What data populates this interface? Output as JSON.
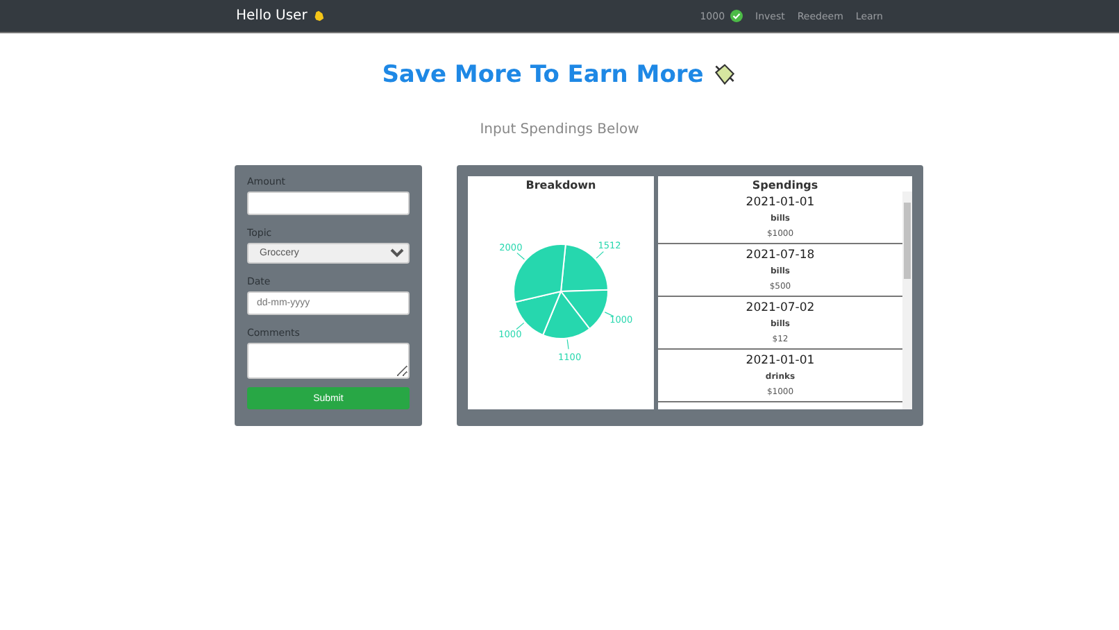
{
  "navbar": {
    "greeting": "Hello User",
    "points": "1000",
    "links": [
      "Invest",
      "Reedeem",
      "Learn"
    ]
  },
  "header": {
    "title": "Save More To Earn More",
    "subtitle": "Input Spendings Below"
  },
  "form": {
    "fields": [
      {
        "kind": "text",
        "label": "Amount"
      },
      {
        "kind": "select",
        "label": "Topic",
        "value": "Groccery"
      },
      {
        "kind": "date",
        "label": "Date",
        "placeholder": "dd-mm-yyyy"
      },
      {
        "kind": "textarea",
        "label": "Comments"
      }
    ],
    "submit": "Submit"
  },
  "breakdown": {
    "title": "Breakdown",
    "chart_data": {
      "type": "pie",
      "values": [
        1512,
        1000,
        1100,
        1000,
        2000
      ],
      "data_labels": true
    }
  },
  "spendings": {
    "title": "Spendings",
    "items": [
      {
        "date": "2021-01-01",
        "topic": "bills",
        "amount": "$1000"
      },
      {
        "date": "2021-07-18",
        "topic": "bills",
        "amount": "$500"
      },
      {
        "date": "2021-07-02",
        "topic": "bills",
        "amount": "$12"
      },
      {
        "date": "2021-01-01",
        "topic": "drinks",
        "amount": "$1000"
      }
    ]
  }
}
